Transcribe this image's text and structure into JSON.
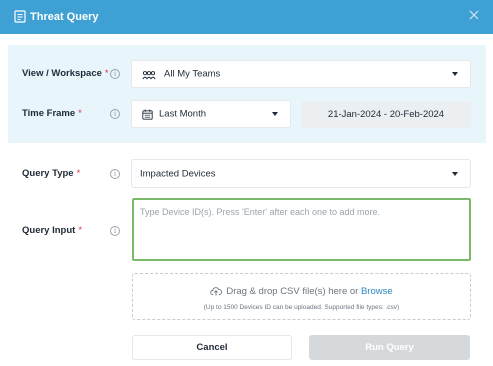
{
  "dialog": {
    "title": "Threat Query"
  },
  "workspace": {
    "label": "View / Workspace",
    "required_mark": "*",
    "value": "All My Teams"
  },
  "time_frame": {
    "label": "Time Frame",
    "required_mark": "*",
    "value": "Last Month",
    "date_range": "21-Jan-2024 - 20-Feb-2024"
  },
  "query_type": {
    "label": "Query Type",
    "required_mark": "*",
    "value": "Impacted Devices"
  },
  "query_input": {
    "label": "Query Input",
    "required_mark": "*",
    "placeholder": "Type Device ID(s). Press 'Enter' after each one to add more."
  },
  "upload": {
    "prompt": "Drag & drop CSV file(s) here or",
    "browse_label": "Browse",
    "hint": "(Up to 1500 Devices ID can be uploaded. Supported file types: .csv)"
  },
  "actions": {
    "cancel_label": "Cancel",
    "run_label": "Run Query"
  },
  "colors": {
    "header": "#3fa0d4",
    "panel": "#e8f5fb",
    "required": "#d8383f",
    "focus_border": "#7bb96a",
    "link": "#2f86c3",
    "disabled_button": "#d6d9dc"
  }
}
